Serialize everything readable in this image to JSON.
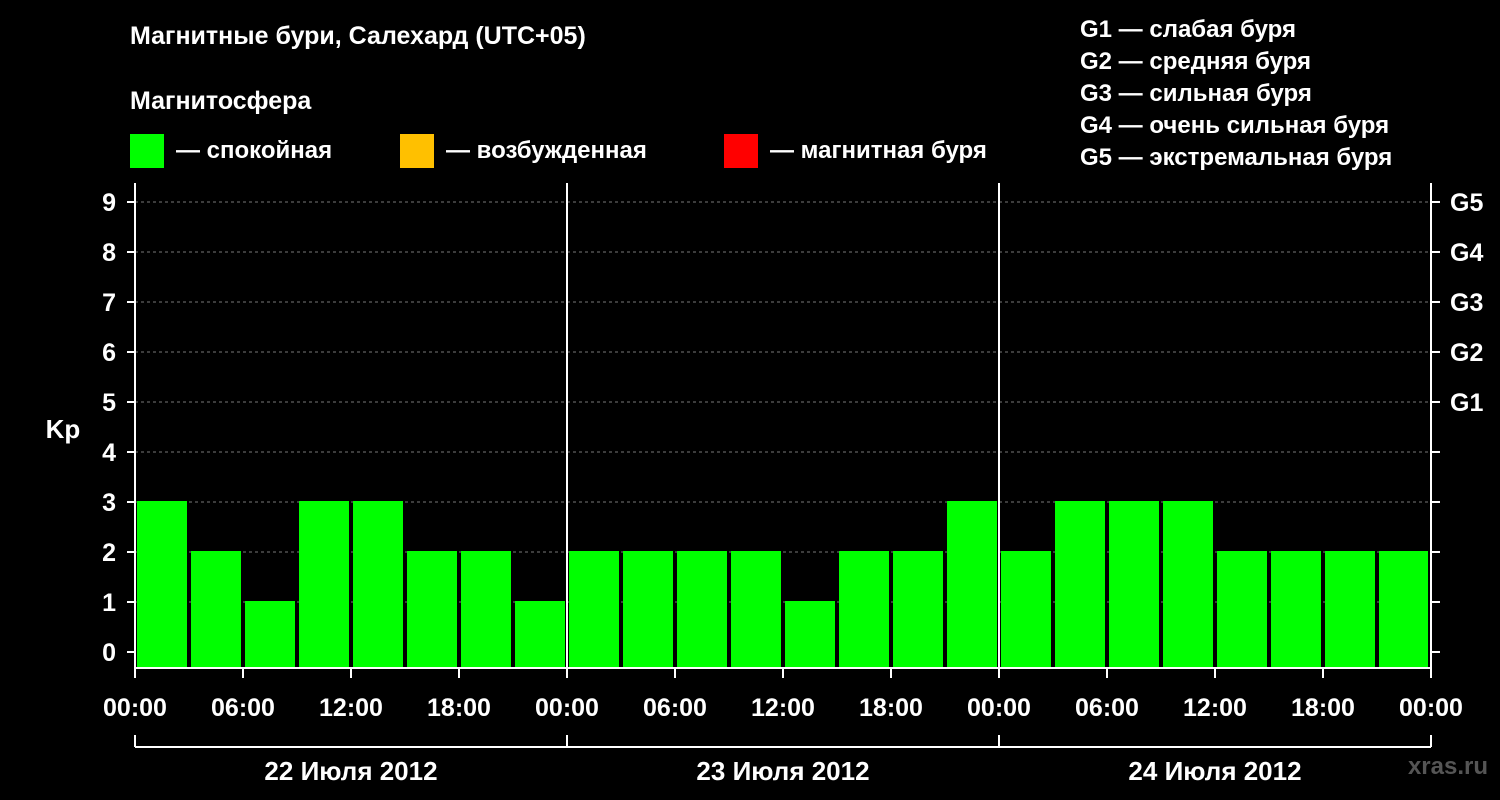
{
  "header": {
    "title": "Магнитные бури, Салехард (UTC+05)",
    "subtitle": "Магнитосфера"
  },
  "legend": [
    {
      "label": "— спокойная",
      "color": "#00ff00"
    },
    {
      "label": "— возбужденная",
      "color": "#ffc000"
    },
    {
      "label": "— магнитная буря",
      "color": "#ff0000"
    }
  ],
  "g_legend": [
    "G1 — слабая буря",
    "G2 — средняя буря",
    "G3 — сильная буря",
    "G4 — очень сильная буря",
    "G5 — экстремальная буря"
  ],
  "watermark": "xras.ru",
  "chart_data": {
    "type": "bar",
    "ylabel": "Kp",
    "ylim": [
      0,
      9
    ],
    "y_ticks": [
      "0",
      "1",
      "2",
      "3",
      "4",
      "5",
      "6",
      "7",
      "8",
      "9"
    ],
    "right_ticks": [
      {
        "kp": 5,
        "label": "G1"
      },
      {
        "kp": 6,
        "label": "G2"
      },
      {
        "kp": 7,
        "label": "G3"
      },
      {
        "kp": 8,
        "label": "G4"
      },
      {
        "kp": 9,
        "label": "G5"
      }
    ],
    "x_tick_labels": [
      "00:00",
      "06:00",
      "12:00",
      "18:00",
      "00:00",
      "06:00",
      "12:00",
      "18:00",
      "00:00",
      "06:00",
      "12:00",
      "18:00",
      "00:00"
    ],
    "days": [
      "22 Июля 2012",
      "23 Июля 2012",
      "24 Июля 2012"
    ],
    "grid": true,
    "bar_interval_hours": 3,
    "colors": {
      "calm": "#00ff00",
      "excited": "#ffc000",
      "storm": "#ff0000"
    },
    "values": [
      3,
      2,
      1,
      3,
      3,
      2,
      2,
      1,
      2,
      2,
      2,
      2,
      1,
      2,
      2,
      3,
      2,
      3,
      3,
      3,
      2,
      2,
      2,
      2
    ]
  }
}
